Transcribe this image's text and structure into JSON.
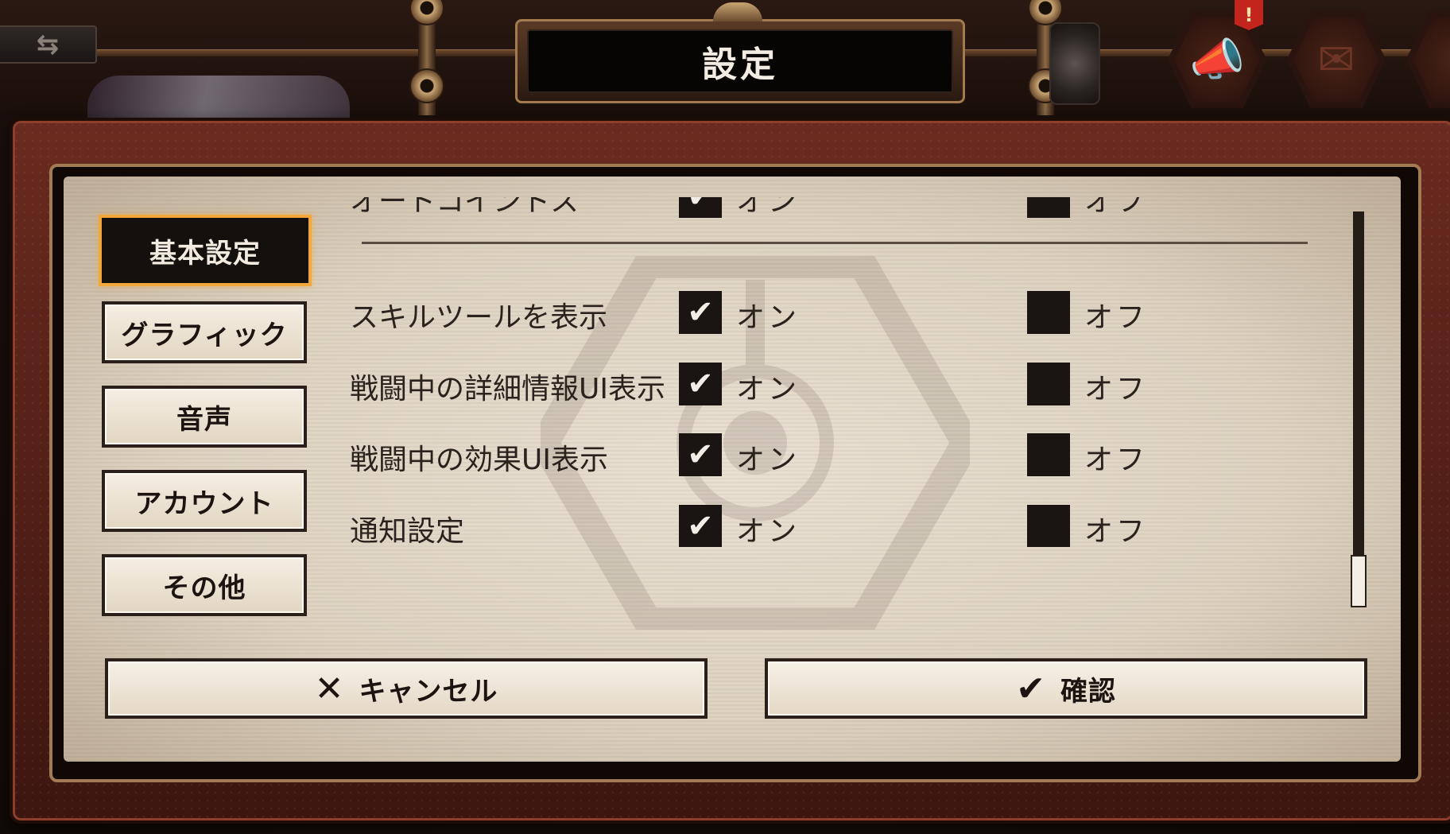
{
  "header": {
    "title": "設定",
    "back_icon": "⇆",
    "notify_badge": "!",
    "announce_icon": "📣",
    "mail_icon": "✉"
  },
  "tabs": [
    {
      "label": "基本設定",
      "active": true
    },
    {
      "label": "グラフィック",
      "active": false
    },
    {
      "label": "音声",
      "active": false
    },
    {
      "label": "アカウント",
      "active": false
    },
    {
      "label": "その他",
      "active": false
    }
  ],
  "settings": {
    "rows": [
      {
        "label": "オートコイントス",
        "on": "オン",
        "off": "オフ",
        "selected": "on"
      },
      {
        "label": "スキルツールを表示",
        "on": "オン",
        "off": "オフ",
        "selected": "on"
      },
      {
        "label": "戦闘中の詳細情報UI表示",
        "on": "オン",
        "off": "オフ",
        "selected": "on"
      },
      {
        "label": "戦闘中の効果UI表示",
        "on": "オン",
        "off": "オフ",
        "selected": "on"
      },
      {
        "label": "通知設定",
        "on": "オン",
        "off": "オフ",
        "selected": "on"
      }
    ],
    "check_glyph": "✔"
  },
  "footer": {
    "cancel_label": "キャンセル",
    "cancel_icon": "✕",
    "confirm_label": "確認",
    "confirm_icon": "✔"
  }
}
